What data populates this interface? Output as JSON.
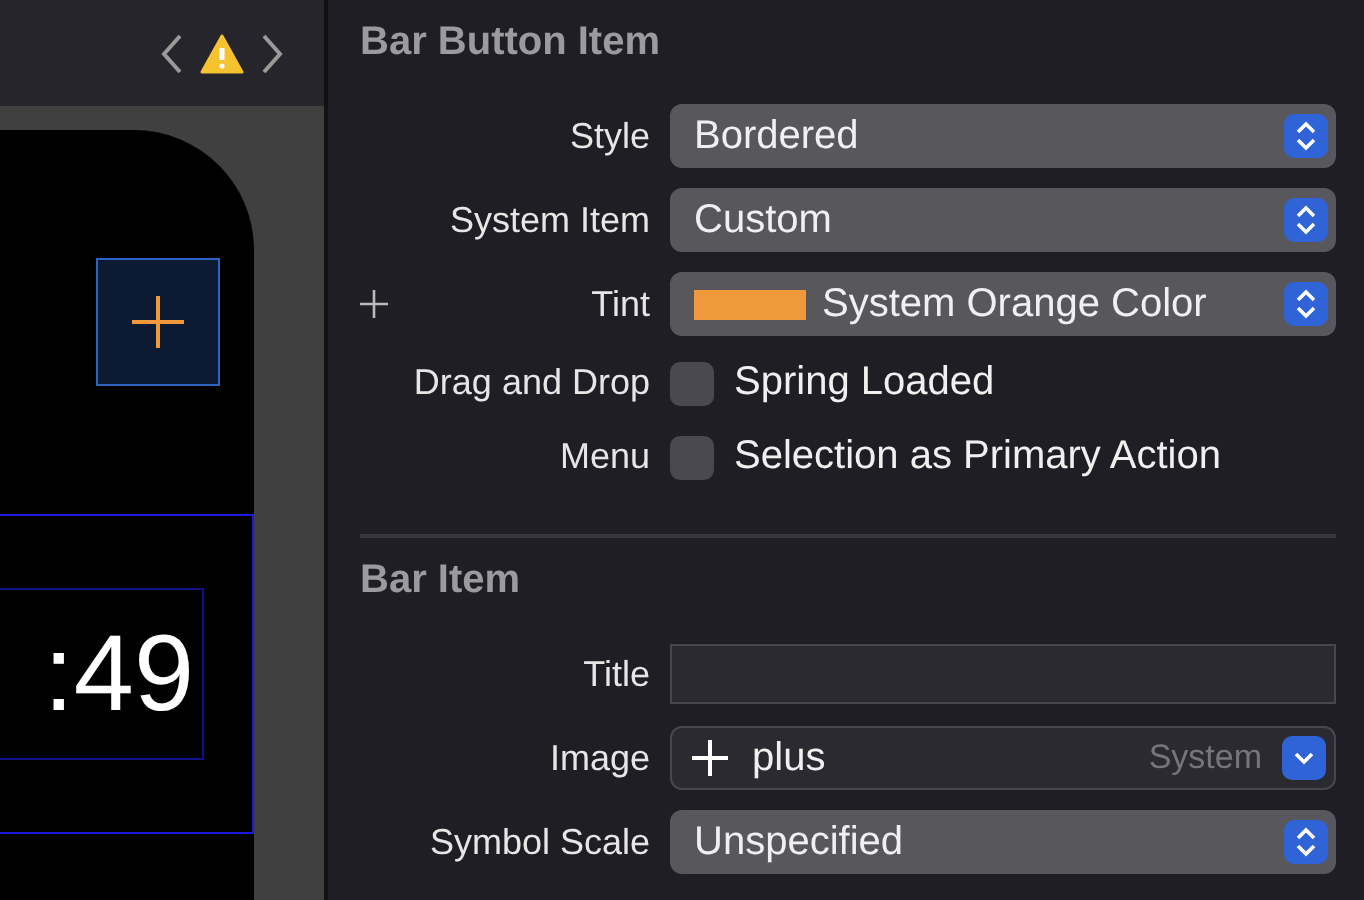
{
  "canvas": {
    "time_label": ":49"
  },
  "sections": [
    {
      "title": "Bar Button Item",
      "rows": [
        {
          "kind": "popup",
          "label": "Style",
          "value": "Bordered"
        },
        {
          "kind": "popup",
          "label": "System Item",
          "value": "Custom"
        },
        {
          "kind": "color",
          "label": "Tint",
          "value": "System Orange Color",
          "color": "#f0993a"
        },
        {
          "kind": "checkbox",
          "label": "Drag and Drop",
          "value": "Spring Loaded",
          "checked": false
        },
        {
          "kind": "checkbox",
          "label": "Menu",
          "value": "Selection as Primary Action",
          "checked": false
        }
      ]
    },
    {
      "title": "Bar Item",
      "rows": [
        {
          "kind": "text",
          "label": "Title",
          "value": ""
        },
        {
          "kind": "image",
          "label": "Image",
          "value": "plus",
          "source": "System"
        },
        {
          "kind": "popup",
          "label": "Symbol Scale",
          "value": "Unspecified"
        }
      ]
    }
  ]
}
